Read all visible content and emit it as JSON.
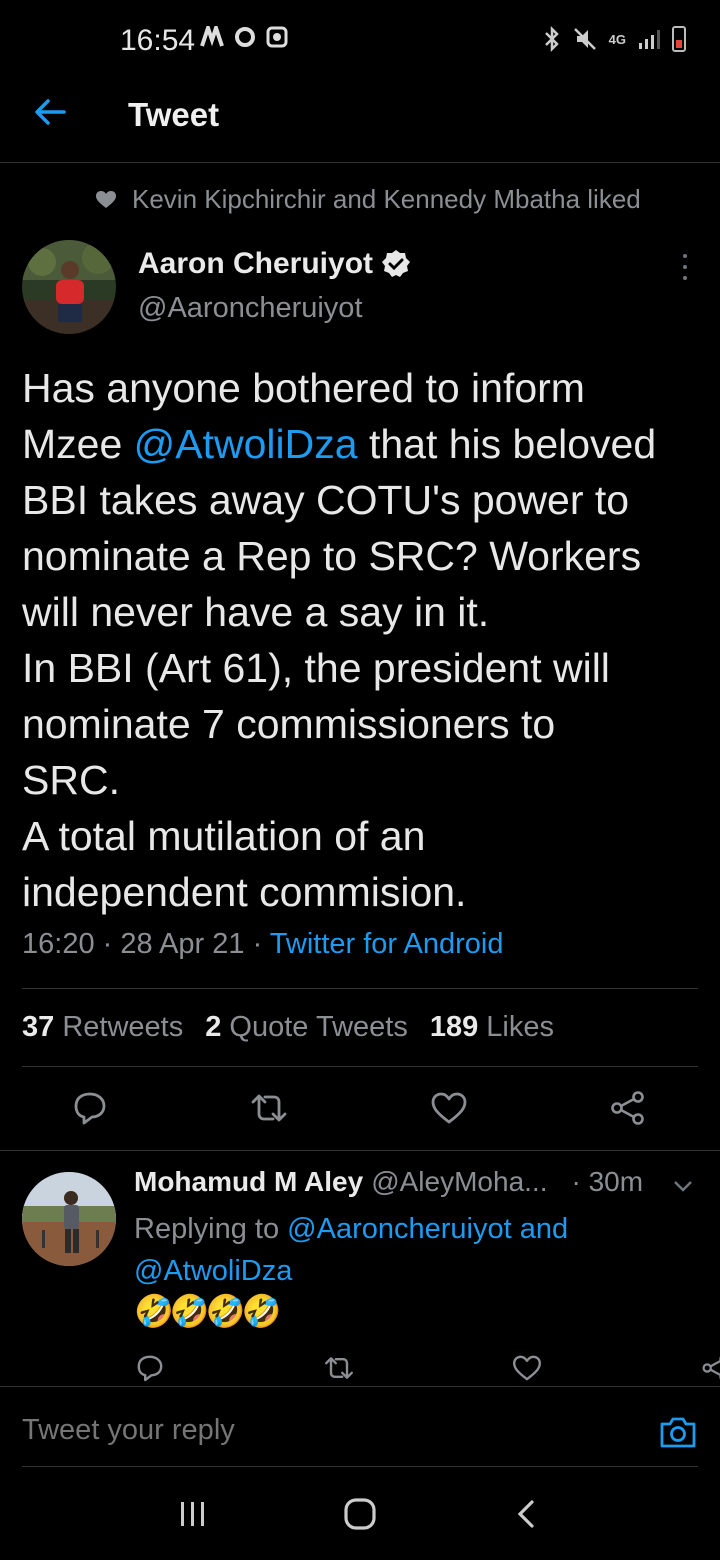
{
  "status_bar": {
    "time": "16:54",
    "network": "4G"
  },
  "header": {
    "title": "Tweet"
  },
  "social_context": {
    "text": "Kevin Kipchirchir and Kennedy Mbatha liked"
  },
  "tweet": {
    "author_name": "Aaron Cheruiyot",
    "author_handle": "@Aaroncheruiyot",
    "lines": [
      "Has anyone bothered to inform",
      [
        "Mzee ",
        "@AtwoliDza",
        " that his beloved"
      ],
      "BBI takes away COTU's power to",
      "nominate a Rep to SRC? Workers",
      "will never have a say in it.",
      "In BBI (Art 61), the president will",
      "nominate 7 commissioners to",
      "SRC.",
      "A total mutilation of an",
      "independent commision."
    ],
    "line1": "Has anyone bothered to inform",
    "line2_pre": "Mzee ",
    "line2_mention": "@AtwoliDza",
    "line2_post": " that his beloved",
    "line3": "BBI takes away COTU's power to",
    "line4": "nominate a Rep to SRC? Workers",
    "line5": "will never have a say in it.",
    "line6": "In BBI (Art 61), the president will",
    "line7": "nominate 7 commissioners to",
    "line8": "SRC.",
    "line9": "A total mutilation of an",
    "line10": "independent commision.",
    "time": "16:20",
    "date": "28 Apr 21",
    "source": "Twitter for Android",
    "retweets_count": "37",
    "retweets_label": "Retweets",
    "quotes_count": "2",
    "quotes_label": "Quote Tweets",
    "likes_count": "189",
    "likes_label": "Likes"
  },
  "reply": {
    "name": "Mohamud M Aley",
    "handle": "@AleyMoha...",
    "time": "· 30m",
    "replying_prefix": "Replying to ",
    "replying_to_1": "@Aaroncheruiyot",
    "replying_and": " and",
    "replying_to_2": "@AtwoliDza",
    "emoji": "🤣🤣🤣🤣"
  },
  "compose": {
    "placeholder": "Tweet your reply"
  },
  "colors": {
    "background": "#000000",
    "accent": "#1d9bf0",
    "muted": "#8b8f94",
    "divider": "#2f3336"
  },
  "icons": [
    "back-arrow-icon",
    "verified-icon",
    "more-icon",
    "reply-icon",
    "retweet-icon",
    "like-icon",
    "share-icon",
    "chevron-down-icon",
    "camera-icon",
    "recents-icon",
    "home-icon",
    "nav-back-icon"
  ]
}
